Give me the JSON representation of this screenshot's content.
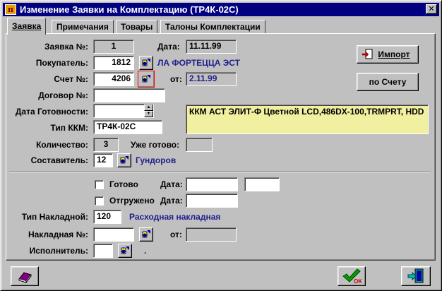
{
  "window": {
    "title": "Изменение Заявки на Комплектацию  (ТР4К-02С)"
  },
  "tabs": [
    "Заявка",
    "Примечания",
    "Товары",
    "Талоны Комплектации"
  ],
  "form": {
    "zayavka_label": "Заявка №:",
    "zayavka_value": "1",
    "date_label": "Дата:",
    "date_value": "11.11.99",
    "buyer_label": "Покупатель:",
    "buyer_code": "1812",
    "buyer_name": "ЛА ФОРТЕЦЦА ЭСТ",
    "invoice_label": "Счет №:",
    "invoice_value": "4206",
    "from_label": "от:",
    "invoice_date": "2.11.99",
    "contract_label": "Договор №:",
    "contract_value": "",
    "ready_date_label": "Дата Готовности:",
    "ready_date_value": "",
    "kkm_type_label": "Тип ККМ:",
    "kkm_type_value": "ТР4К-02С",
    "kkm_description": "ККМ АСТ ЭЛИТ-Ф Цветной LCD,486DX-100,TRMPRT, HDD",
    "quantity_label": "Количество:",
    "quantity_value": "3",
    "ready_already_label": "Уже готово:",
    "ready_already_value": "",
    "author_label": "Составитель:",
    "author_code": "12",
    "author_name": "Гундоров",
    "ready_check_label": "Готово",
    "ready_date2_label": "Дата:",
    "ready_date2_value": "",
    "ready_extra_value": "",
    "shipped_check_label": "Отгружено",
    "shipped_date_label": "Дата:",
    "shipped_date_value": "",
    "waybill_type_label": "Тип Накладной:",
    "waybill_type_code": "120",
    "waybill_type_name": "Расходная накладная",
    "waybill_no_label": "Накладная №:",
    "waybill_no_value": "",
    "waybill_from_label": "от:",
    "waybill_date_value": "",
    "executor_label": "Исполнитель:",
    "executor_code": "",
    "executor_name": "."
  },
  "buttons": {
    "import_label": "Импорт",
    "by_invoice_label": "по Счету"
  },
  "icons": {
    "app": "app-icon",
    "close": "close-icon",
    "lookup": "lookup-icon",
    "import": "import-icon",
    "book": "book-icon",
    "ok": "ok-check-icon",
    "exit": "exit-door-icon"
  },
  "colors": {
    "titlebar": "#000080",
    "face": "#c0c0c0",
    "memo": "#f0f0a0",
    "link_text": "#1e1e8c",
    "focus": "#ff0000"
  }
}
